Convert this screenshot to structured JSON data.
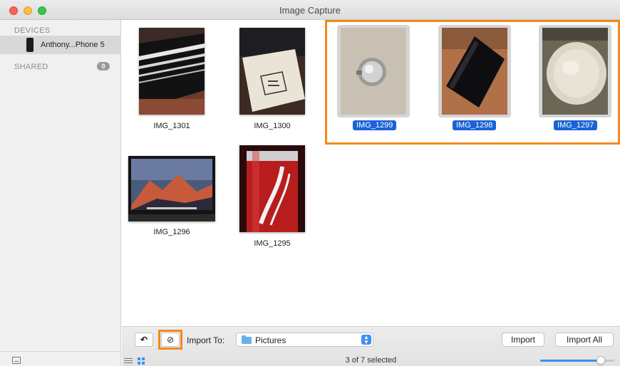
{
  "window": {
    "title": "Image Capture"
  },
  "sidebar": {
    "devices_heading": "DEVICES",
    "device_name": "Anthony...Phone 5",
    "shared_heading": "SHARED",
    "shared_count": "0"
  },
  "photos": [
    {
      "name": "IMG_1301",
      "selected": false
    },
    {
      "name": "IMG_1300",
      "selected": false
    },
    {
      "name": "IMG_1299",
      "selected": true
    },
    {
      "name": "IMG_1298",
      "selected": true
    },
    {
      "name": "IMG_1297",
      "selected": true
    },
    {
      "name": "IMG_1296",
      "selected": false
    },
    {
      "name": "IMG_1295",
      "selected": false
    }
  ],
  "toolbar": {
    "rotate_label": "↶",
    "delete_label": "⊘",
    "import_to_label": "Import To:",
    "destination": "Pictures",
    "import_label": "Import",
    "import_all_label": "Import All",
    "status": "3 of 7 selected",
    "thumbnail_size": 0.82
  },
  "colors": {
    "selection": "#1a63d6",
    "highlight": "#f28a1d",
    "accent": "#3c8ff5"
  }
}
